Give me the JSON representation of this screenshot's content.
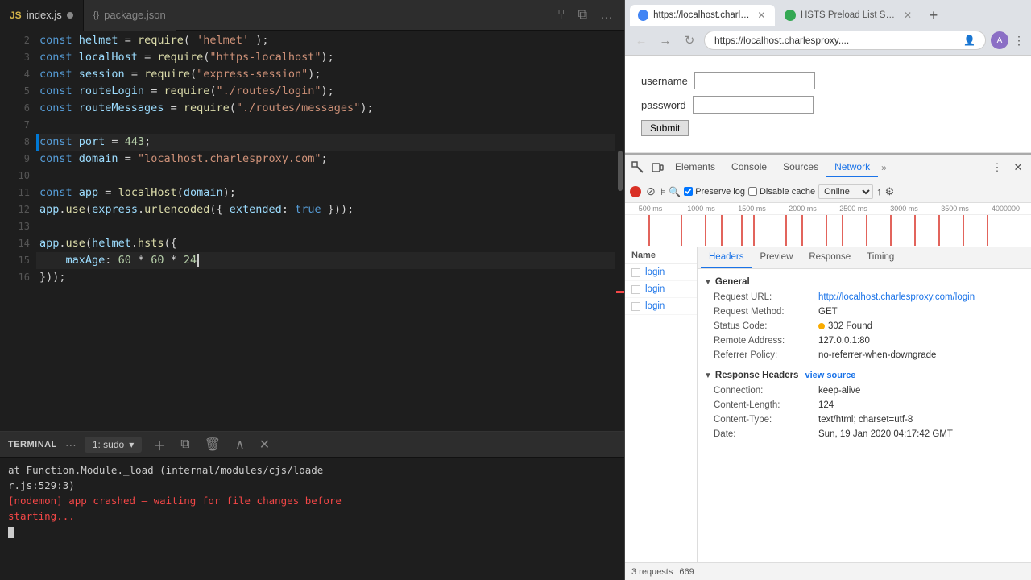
{
  "editor": {
    "tabs": [
      {
        "id": "index-js",
        "icon": "js",
        "label": "index.js",
        "modified": true,
        "active": true
      },
      {
        "id": "package-json",
        "icon": "json",
        "label": "package.json",
        "modified": false,
        "active": false
      }
    ],
    "toolbar": {
      "branch_icon": "⑂",
      "layout_icon": "⧉",
      "more_icon": "…"
    },
    "lines": [
      {
        "num": 2,
        "tokens": [
          {
            "t": "kw",
            "v": "const "
          },
          {
            "t": "var",
            "v": "helmet"
          },
          {
            "t": "plain",
            "v": " = "
          },
          {
            "t": "fn",
            "v": "require"
          },
          {
            "t": "plain",
            "v": "( "
          },
          {
            "t": "str",
            "v": "'helmet'"
          },
          {
            "t": "plain",
            "v": " );"
          }
        ]
      },
      {
        "num": 3,
        "tokens": [
          {
            "t": "kw",
            "v": "const "
          },
          {
            "t": "var",
            "v": "localHost"
          },
          {
            "t": "plain",
            "v": " = "
          },
          {
            "t": "fn",
            "v": "require"
          },
          {
            "t": "plain",
            "v": "("
          },
          {
            "t": "str",
            "v": "\"https-localhost\""
          },
          {
            "t": "plain",
            "v": ");"
          }
        ]
      },
      {
        "num": 4,
        "tokens": [
          {
            "t": "kw",
            "v": "const "
          },
          {
            "t": "var",
            "v": "session"
          },
          {
            "t": "plain",
            "v": " = "
          },
          {
            "t": "fn",
            "v": "require"
          },
          {
            "t": "plain",
            "v": "("
          },
          {
            "t": "str",
            "v": "\"express-session\""
          },
          {
            "t": "plain",
            "v": ");"
          }
        ]
      },
      {
        "num": 5,
        "tokens": [
          {
            "t": "kw",
            "v": "const "
          },
          {
            "t": "var",
            "v": "routeLogin"
          },
          {
            "t": "plain",
            "v": " = "
          },
          {
            "t": "fn",
            "v": "require"
          },
          {
            "t": "plain",
            "v": "("
          },
          {
            "t": "str",
            "v": "\"./routes/login\""
          },
          {
            "t": "plain",
            "v": ");"
          }
        ]
      },
      {
        "num": 6,
        "tokens": [
          {
            "t": "kw",
            "v": "const "
          },
          {
            "t": "var",
            "v": "routeMessages"
          },
          {
            "t": "plain",
            "v": " = "
          },
          {
            "t": "fn",
            "v": "require"
          },
          {
            "t": "plain",
            "v": "("
          },
          {
            "t": "str",
            "v": "\"./routes/messages\""
          },
          {
            "t": "plain",
            "v": ");"
          }
        ]
      },
      {
        "num": 7,
        "tokens": []
      },
      {
        "num": 8,
        "tokens": [
          {
            "t": "kw",
            "v": "const "
          },
          {
            "t": "var",
            "v": "port"
          },
          {
            "t": "plain",
            "v": " = "
          },
          {
            "t": "num",
            "v": "443"
          },
          {
            "t": "plain",
            "v": ";"
          }
        ],
        "indicator": true
      },
      {
        "num": 9,
        "tokens": [
          {
            "t": "kw",
            "v": "const "
          },
          {
            "t": "var",
            "v": "domain"
          },
          {
            "t": "plain",
            "v": " = "
          },
          {
            "t": "str",
            "v": "\"localhost.charlesproxy.com\""
          },
          {
            "t": "plain",
            "v": ";"
          }
        ]
      },
      {
        "num": 10,
        "tokens": []
      },
      {
        "num": 11,
        "tokens": [
          {
            "t": "kw",
            "v": "const "
          },
          {
            "t": "var",
            "v": "app"
          },
          {
            "t": "plain",
            "v": " = "
          },
          {
            "t": "fn",
            "v": "localHost"
          },
          {
            "t": "plain",
            "v": "("
          },
          {
            "t": "var",
            "v": "domain"
          },
          {
            "t": "plain",
            "v": ");"
          }
        ]
      },
      {
        "num": 12,
        "tokens": [
          {
            "t": "var",
            "v": "app"
          },
          {
            "t": "plain",
            "v": "."
          },
          {
            "t": "fn",
            "v": "use"
          },
          {
            "t": "plain",
            "v": "("
          },
          {
            "t": "var",
            "v": "express"
          },
          {
            "t": "plain",
            "v": "."
          },
          {
            "t": "fn",
            "v": "urlencoded"
          },
          {
            "t": "plain",
            "v": "({ "
          },
          {
            "t": "var",
            "v": "extended"
          },
          {
            "t": "plain",
            "v": ": "
          },
          {
            "t": "kw",
            "v": "true "
          },
          {
            "t": "plain",
            "v": "}));"
          }
        ]
      },
      {
        "num": 13,
        "tokens": []
      },
      {
        "num": 14,
        "tokens": [
          {
            "t": "var",
            "v": "app"
          },
          {
            "t": "plain",
            "v": "."
          },
          {
            "t": "fn",
            "v": "use"
          },
          {
            "t": "plain",
            "v": "("
          },
          {
            "t": "var",
            "v": "helmet"
          },
          {
            "t": "plain",
            "v": "."
          },
          {
            "t": "fn",
            "v": "hsts"
          },
          {
            "t": "plain",
            "v": "({"
          }
        ]
      },
      {
        "num": 15,
        "tokens": [
          {
            "t": "plain",
            "v": "    "
          },
          {
            "t": "var",
            "v": "maxAge"
          },
          {
            "t": "plain",
            "v": ": "
          },
          {
            "t": "num",
            "v": "60"
          },
          {
            "t": "plain",
            "v": " * "
          },
          {
            "t": "num",
            "v": "60"
          },
          {
            "t": "plain",
            "v": " * "
          },
          {
            "t": "num",
            "v": "24"
          },
          {
            "t": "plain",
            "v": "|"
          }
        ],
        "cursor": true
      },
      {
        "num": 16,
        "tokens": [
          {
            "t": "plain",
            "v": "}));"
          }
        ]
      }
    ]
  },
  "terminal": {
    "title": "TERMINAL",
    "dropdown_label": "1: sudo",
    "content": [
      {
        "type": "normal",
        "text": "at Function.Module._load (internal/modules/cjs/loade"
      },
      {
        "type": "normal",
        "text": "r.js:529:3)"
      },
      {
        "type": "error",
        "text": "[nodemon] app crashed – waiting for file changes before"
      },
      {
        "type": "error",
        "text": "starting..."
      }
    ]
  },
  "browser": {
    "tabs": [
      {
        "id": "localhost",
        "label": "https://localhost.charles...",
        "active": true,
        "icon_color": "#4285f4"
      },
      {
        "id": "hsts",
        "label": "HSTS Preload List Subm...",
        "active": false,
        "icon_color": "#34a853"
      }
    ],
    "address": "https://localhost.charlesproxy....",
    "form": {
      "username_label": "username",
      "password_label": "password",
      "submit_label": "Submit"
    },
    "devtools": {
      "tabs": [
        {
          "id": "elements",
          "label": "Elements",
          "active": false
        },
        {
          "id": "console",
          "label": "Console",
          "active": false
        },
        {
          "id": "sources",
          "label": "Sources",
          "active": false
        },
        {
          "id": "network",
          "label": "Network",
          "active": true
        }
      ],
      "network_toolbar": {
        "preserve_log_label": "Preserve log",
        "disable_cache_label": "Disable cache",
        "online_label": "Online",
        "preserve_log_checked": true,
        "disable_cache_checked": false
      },
      "timeline": {
        "labels": [
          "500 ms",
          "1000 ms",
          "1500 ms",
          "2000 ms",
          "2500 ms",
          "3000 ms",
          "3500 ms",
          "4000000"
        ]
      },
      "requests": [
        {
          "name": "login"
        },
        {
          "name": "login"
        },
        {
          "name": "login"
        }
      ],
      "request_list_header": "Name",
      "detail": {
        "tabs": [
          {
            "id": "headers",
            "label": "Headers",
            "active": true
          },
          {
            "id": "preview",
            "label": "Preview",
            "active": false
          },
          {
            "id": "response",
            "label": "Response",
            "active": false
          },
          {
            "id": "timing",
            "label": "Timing",
            "active": false
          }
        ],
        "sections": [
          {
            "id": "general",
            "title": "General",
            "rows": [
              {
                "key": "Request URL:",
                "value": "http://localhost.charlesproxy.com/login",
                "type": "url"
              },
              {
                "key": "Request Method:",
                "value": "GET",
                "type": "normal"
              },
              {
                "key": "Status Code:",
                "value": "302 Found",
                "type": "status"
              },
              {
                "key": "Remote Address:",
                "value": "127.0.0.1:80",
                "type": "normal"
              },
              {
                "key": "Referrer Policy:",
                "value": "no-referrer-when-downgrade",
                "type": "normal"
              }
            ]
          },
          {
            "id": "response-headers",
            "title": "Response Headers",
            "view_source": "view source",
            "rows": [
              {
                "key": "Connection:",
                "value": "keep-alive",
                "type": "normal"
              },
              {
                "key": "Content-Length:",
                "value": "124",
                "type": "normal"
              },
              {
                "key": "Content-Type:",
                "value": "text/html; charset=utf-8",
                "type": "normal"
              },
              {
                "key": "Date:",
                "value": "Sun, 19 Jan 2020 04:17:42 GMT",
                "type": "normal"
              }
            ]
          }
        ]
      },
      "status_bar": {
        "requests_count": "3 requests",
        "size": "669"
      }
    }
  }
}
